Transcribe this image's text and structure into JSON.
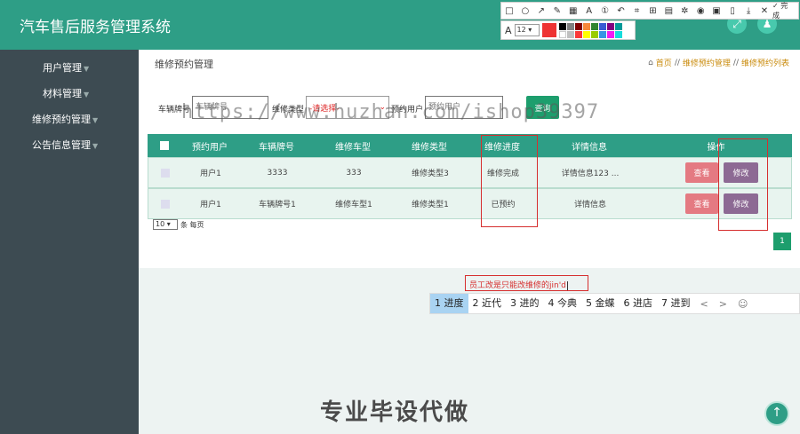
{
  "header": {
    "title": "汽车售后服务管理系统"
  },
  "sidebar": {
    "items": [
      {
        "label": "用户管理"
      },
      {
        "label": "材料管理"
      },
      {
        "label": "维修预约管理"
      },
      {
        "label": "公告信息管理"
      }
    ]
  },
  "page": {
    "heading": "维修预约管理",
    "breadcrumb": [
      "首页",
      "维修预约管理",
      "维修预约列表"
    ]
  },
  "filters": {
    "plate_label": "车辆牌号",
    "plate_placeholder": "车辆牌号",
    "type_label": "维修类型",
    "type_value": "-请选择-",
    "user_label": "预约用户",
    "user_placeholder": "预约用户",
    "query_label": "查询"
  },
  "table": {
    "headers": [
      "预约用户",
      "车辆牌号",
      "维修车型",
      "维修类型",
      "维修进度",
      "详情信息",
      "操作"
    ],
    "rows": [
      {
        "user": "用户1",
        "plate": "3333",
        "model": "333",
        "type": "维修类型3",
        "progress": "维修完成",
        "detail": "详情信息123 ...",
        "view": "查看",
        "edit": "修改"
      },
      {
        "user": "用户1",
        "plate": "车辆牌号1",
        "model": "维修车型1",
        "type": "维修类型1",
        "progress": "已预约",
        "detail": "详情信息",
        "view": "查看",
        "edit": "修改"
      }
    ]
  },
  "pagination": {
    "page_size": "10",
    "page_size_suffix": "条 每页",
    "current_page": "1"
  },
  "annotation": {
    "text": "员工改是只能改维修的jin'd"
  },
  "ime": {
    "candidates": [
      "1 进度",
      "2 近代",
      "3 进的",
      "4 今典",
      "5 金蝶",
      "6 进店",
      "7 进到"
    ],
    "prev": "<",
    "next": ">",
    "emoji": "☺"
  },
  "watermark": {
    "url": "https://www.huzhan.com/ishop39397",
    "banner": "专业毕设代做"
  },
  "snip_toolbar": {
    "done_label": "完成",
    "font_size": "12",
    "accent": "#ee3333"
  },
  "colors": {
    "primary": "#2e9e86",
    "sidebar": "#3d4b52",
    "view_btn": "#e47a82",
    "edit_btn": "#8d6a94",
    "highlight": "#d62f2f"
  }
}
